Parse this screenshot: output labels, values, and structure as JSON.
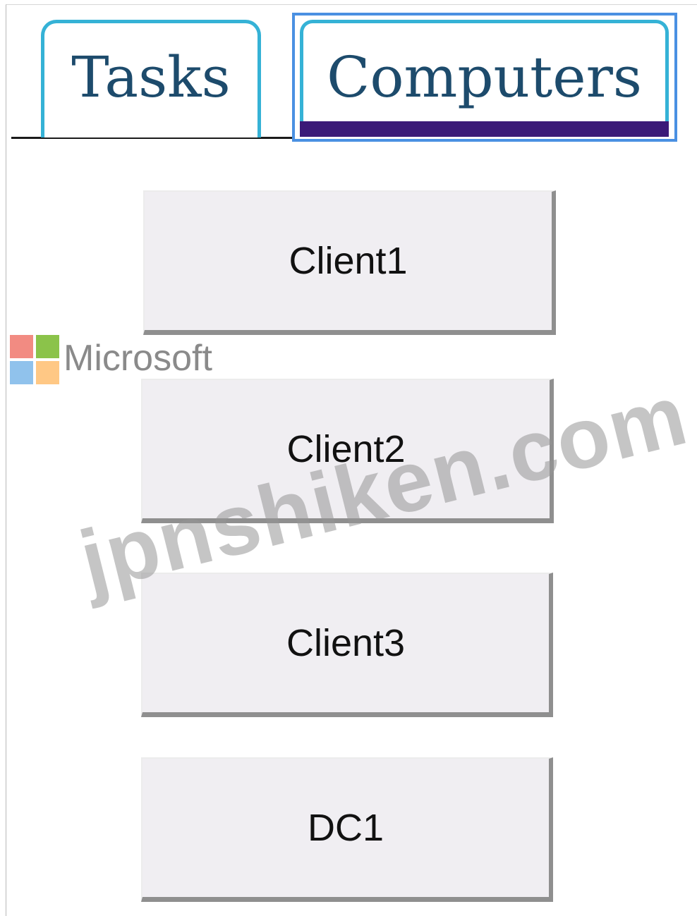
{
  "tabs": [
    {
      "label": "Tasks",
      "active": false
    },
    {
      "label": "Computers",
      "active": true
    }
  ],
  "computers": [
    {
      "label": "Client1"
    },
    {
      "label": "Client2"
    },
    {
      "label": "Client3"
    },
    {
      "label": "DC1"
    }
  ],
  "watermark": {
    "brand": "Microsoft",
    "site": "jpnshiken.com",
    "logo_colors": [
      "#f28b82",
      "#8bc34a",
      "#90c2ec",
      "#ffc885"
    ]
  },
  "colors": {
    "tab_border": "#35b2d6",
    "tab_text": "#1d4b6c",
    "active_tab_focus": "#4a90e2",
    "active_tab_bar": "#3b1a78",
    "button_face": "#f0eef2",
    "button_shadow": "#8f8f8f"
  }
}
